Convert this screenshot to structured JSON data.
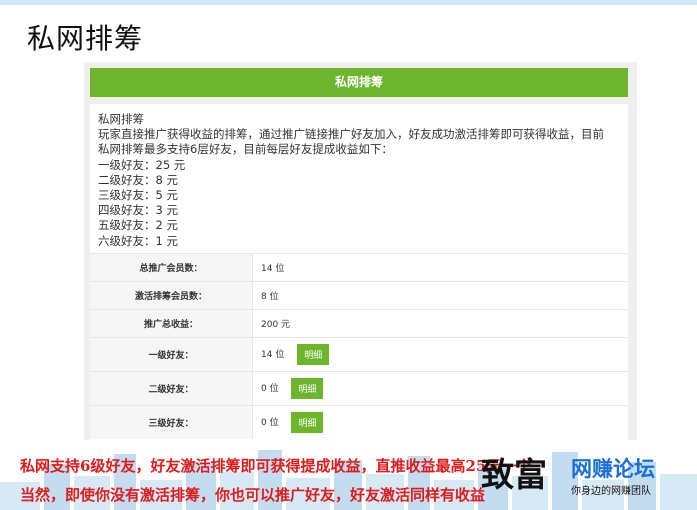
{
  "slide_title": "私网排筹",
  "panel": {
    "header": "私网排筹",
    "intro": {
      "title": "私网排筹",
      "description_1": "玩家直接推广获得收益的排筹，通过推广链接推广好友加入，好友成功激活排筹即可获得收益，目前",
      "description_2": "私网排筹最多支持6层好友，目前每层好友提成收益如下：",
      "tiers": [
        "一级好友：25 元",
        "二级好友：8 元",
        "三级好友：5 元",
        "四级好友：3 元",
        "五级好友：2 元",
        "六级好友：1 元"
      ]
    },
    "rows": [
      {
        "label": "总推广会员数：",
        "value": "14 位"
      },
      {
        "label": "激活排筹会员数：",
        "value": "8 位"
      },
      {
        "label": "推广总收益：",
        "value": "200 元"
      },
      {
        "label": "一级好友：",
        "value": "14 位",
        "button": "明细"
      },
      {
        "label": "二级好友：",
        "value": "0 位",
        "button": "明细"
      },
      {
        "label": "三级好友：",
        "value": "0 位",
        "button": "明细"
      }
    ]
  },
  "caption": {
    "line1": "私网支持6级好友，好友激活排筹即可获得提成收益，直推收益最高25元一个",
    "line2": "当然，即使你没有激活排筹，你也可以推广好友，好友激活同样有收益"
  },
  "watermark": {
    "brand": "致富",
    "forum": "网赚论坛",
    "slogan": "你身边的网赚团队"
  },
  "colors": {
    "accent_green": "#6cb52d",
    "caption_red": "#e01b1b",
    "watermark_blue": "#1a6fd6"
  }
}
